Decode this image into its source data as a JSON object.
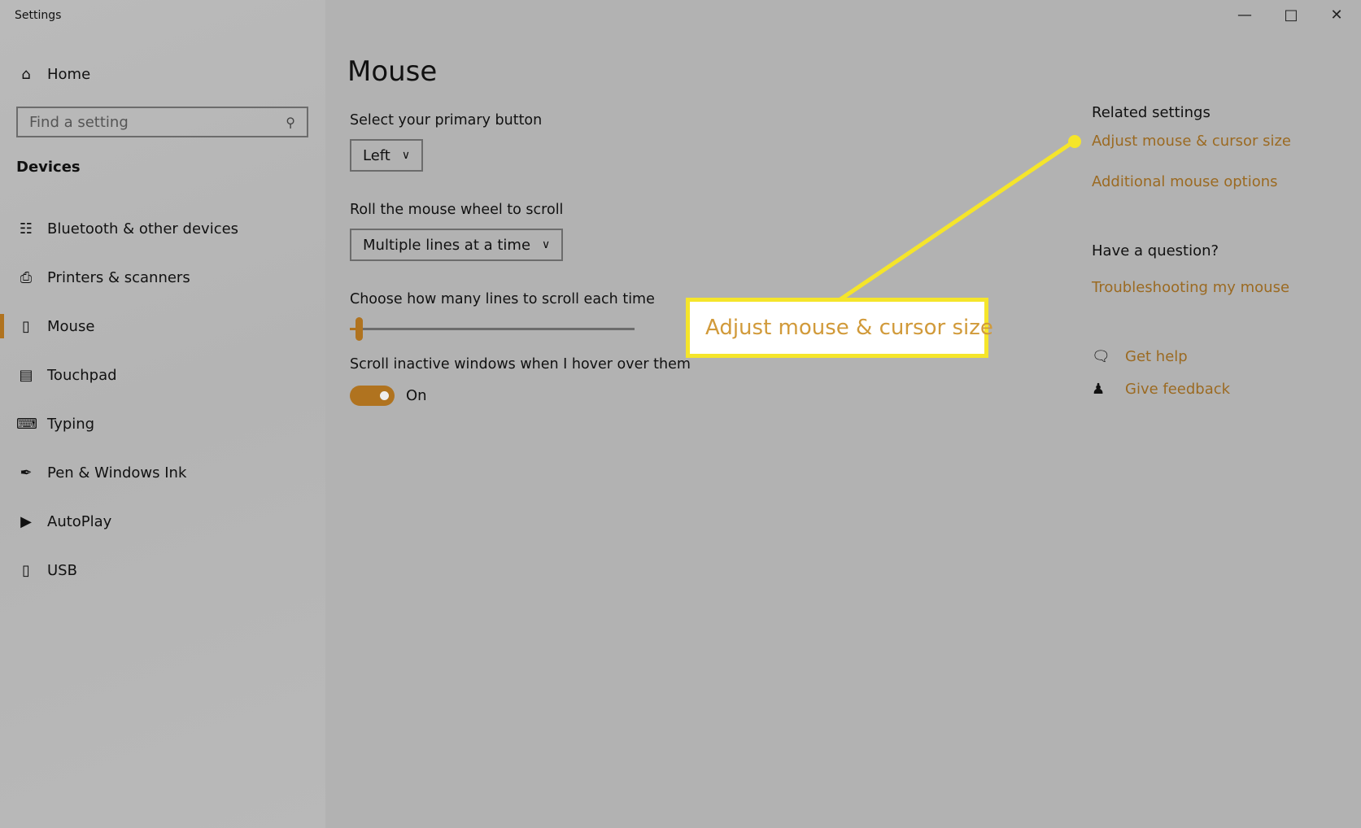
{
  "window": {
    "title": "Settings",
    "minimize_icon": "minimize-icon",
    "maximize_icon": "maximize-icon",
    "close_icon": "close-icon"
  },
  "sidebar": {
    "home": "Home",
    "search_placeholder": "Find a setting",
    "section": "Devices",
    "items": [
      {
        "label": "Bluetooth & other devices",
        "icon": "bluetooth-devices-icon"
      },
      {
        "label": "Printers & scanners",
        "icon": "printer-icon"
      },
      {
        "label": "Mouse",
        "icon": "mouse-icon",
        "selected": true
      },
      {
        "label": "Touchpad",
        "icon": "touchpad-icon"
      },
      {
        "label": "Typing",
        "icon": "keyboard-icon"
      },
      {
        "label": "Pen & Windows Ink",
        "icon": "pen-icon"
      },
      {
        "label": "AutoPlay",
        "icon": "autoplay-icon"
      },
      {
        "label": "USB",
        "icon": "usb-icon"
      }
    ]
  },
  "main": {
    "title": "Mouse",
    "primary_button_label": "Select your primary button",
    "primary_button_value": "Left",
    "wheel_label": "Roll the mouse wheel to scroll",
    "wheel_value": "Multiple lines at a time",
    "lines_label": "Choose how many lines to scroll each time",
    "lines_slider_fraction": 0.03,
    "inactive_label": "Scroll inactive windows when I hover over them",
    "inactive_toggle": "On"
  },
  "related": {
    "heading": "Related settings",
    "links": [
      "Adjust mouse & cursor size",
      "Additional mouse options"
    ],
    "question_heading": "Have a question?",
    "troubleshoot": "Troubleshooting my mouse",
    "get_help": "Get help",
    "give_feedback": "Give feedback"
  },
  "callout": {
    "text": "Adjust mouse & cursor size",
    "color": "#f5e52a"
  },
  "colors": {
    "accent": "#b0731f",
    "link": "#9b6a22"
  }
}
